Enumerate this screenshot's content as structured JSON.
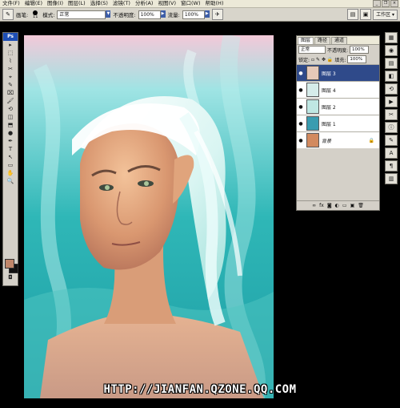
{
  "menu": [
    "文件(F)",
    "编辑(E)",
    "图像(I)",
    "图层(L)",
    "选择(S)",
    "滤镜(T)",
    "分析(A)",
    "视图(V)",
    "窗口(W)",
    "帮助(H)"
  ],
  "options": {
    "brush_label": "画笔:",
    "brush_size": "11",
    "mode_label": "模式:",
    "mode_value": "正常",
    "opacity_label": "不透明度:",
    "opacity_value": "100%",
    "flow_label": "流量:",
    "flow_value": "100%",
    "workspace_label": "工作区 ▾"
  },
  "toolbox": {
    "logo": "Ps",
    "tools": [
      "▸",
      "⬚",
      "⌇",
      "✂",
      "⌖",
      "✎",
      "⌧",
      "🖌",
      "⟲",
      "◫",
      "⬒",
      "●",
      "✒",
      "T",
      "↖",
      "▭",
      "✋",
      "🔍"
    ],
    "fg_color": "#c0866a",
    "bg_color": "#111111"
  },
  "layers_panel": {
    "tabs": [
      "图层",
      "路径",
      "通道"
    ],
    "blend_mode": "正常",
    "opacity_label": "不透明度:",
    "opacity_value": "100%",
    "lock_label": "锁定:",
    "fill_label": "填充:",
    "fill_value": "100%",
    "layers": [
      {
        "name": "图层 3",
        "selected": true
      },
      {
        "name": "图层 4",
        "selected": false
      },
      {
        "name": "图层 2",
        "selected": false
      },
      {
        "name": "图层 1",
        "selected": false
      },
      {
        "name": "背景",
        "selected": false
      }
    ],
    "footer_icons": [
      "link-icon",
      "fx-icon",
      "mask-icon",
      "adjustment-icon",
      "group-icon",
      "new-layer-icon",
      "trash-icon"
    ]
  },
  "watermark": "HTTP://JIANFAN.QZONE.QQ.COM"
}
